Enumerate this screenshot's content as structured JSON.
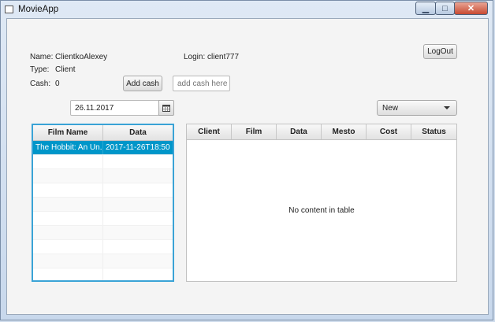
{
  "window": {
    "title": "MovieApp"
  },
  "user": {
    "name_label": "Name:",
    "name_value": "ClientkoAlexey",
    "type_label": "Type:",
    "type_value": "Client",
    "cash_label": "Cash:",
    "cash_value": "0",
    "login_text": "Login: client777"
  },
  "buttons": {
    "add_cash": "Add cash",
    "logout": "LogOut"
  },
  "cash_input": {
    "value": "",
    "placeholder": "add cash here"
  },
  "date_picker": {
    "value": "26.11.2017"
  },
  "status_filter": {
    "selected": "New"
  },
  "films_table": {
    "columns": [
      "Film Name",
      "Data"
    ],
    "rows": [
      {
        "film_name": "The Hobbit: An Un...",
        "data": "2017-11-26T18:50"
      }
    ]
  },
  "orders_table": {
    "columns": [
      "Client",
      "Film",
      "Data",
      "Mesto",
      "Cost",
      "Status"
    ],
    "empty_text": "No content in table"
  },
  "icons": {
    "calendar": "calendar-icon",
    "dropdown": "chevron-down-icon",
    "app": "app-icon"
  }
}
